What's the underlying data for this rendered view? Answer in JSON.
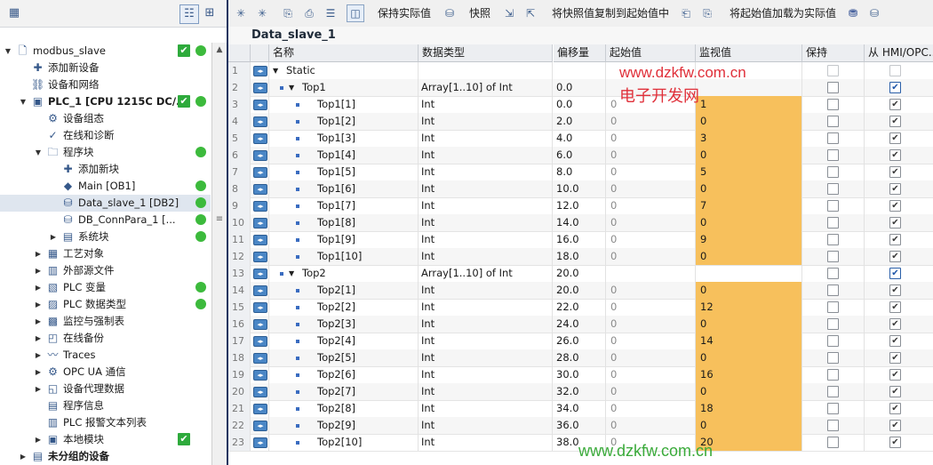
{
  "left_panel": {
    "tree": [
      {
        "label": "modbus_slave",
        "expander": "▼",
        "icon": "document-icon",
        "check": true,
        "dot": true
      },
      {
        "label": "添加新设备",
        "expander": "",
        "icon": "add-device-icon",
        "check": false,
        "dot": false
      },
      {
        "label": "设备和网络",
        "expander": "",
        "icon": "network-icon",
        "check": false,
        "dot": false
      },
      {
        "label": "PLC_1 [CPU 1215C DC/...",
        "expander": "▼",
        "icon": "plc-icon",
        "check": true,
        "dot": true,
        "bold": true
      },
      {
        "label": "设备组态",
        "expander": "",
        "icon": "device-config-icon",
        "check": false,
        "dot": false
      },
      {
        "label": "在线和诊断",
        "expander": "",
        "icon": "diagnostics-icon",
        "check": false,
        "dot": false
      },
      {
        "label": "程序块",
        "expander": "▼",
        "icon": "folder-icon",
        "check": false,
        "dot": true
      },
      {
        "label": "添加新块",
        "expander": "",
        "icon": "add-block-icon",
        "check": false,
        "dot": false
      },
      {
        "label": "Main [OB1]",
        "expander": "",
        "icon": "ob-icon",
        "check": false,
        "dot": true
      },
      {
        "label": "Data_slave_1 [DB2]",
        "expander": "",
        "icon": "db-icon",
        "check": false,
        "dot": true,
        "selected": true
      },
      {
        "label": "DB_ConnPara_1 [...",
        "expander": "",
        "icon": "db-icon",
        "check": false,
        "dot": true
      },
      {
        "label": "系统块",
        "expander": "▶",
        "icon": "system-block-icon",
        "check": false,
        "dot": true
      },
      {
        "label": "工艺对象",
        "expander": "▶",
        "icon": "tech-object-icon",
        "check": false,
        "dot": false
      },
      {
        "label": "外部源文件",
        "expander": "▶",
        "icon": "external-source-icon",
        "check": false,
        "dot": false
      },
      {
        "label": "PLC 变量",
        "expander": "▶",
        "icon": "plc-tags-icon",
        "check": false,
        "dot": true
      },
      {
        "label": "PLC 数据类型",
        "expander": "▶",
        "icon": "plc-datatype-icon",
        "check": false,
        "dot": true
      },
      {
        "label": "监控与强制表",
        "expander": "▶",
        "icon": "watch-table-icon",
        "check": false,
        "dot": false
      },
      {
        "label": "在线备份",
        "expander": "▶",
        "icon": "online-backup-icon",
        "check": false,
        "dot": false
      },
      {
        "label": "Traces",
        "expander": "▶",
        "icon": "traces-icon",
        "check": false,
        "dot": false
      },
      {
        "label": "OPC UA 通信",
        "expander": "▶",
        "icon": "opcua-icon",
        "check": false,
        "dot": false
      },
      {
        "label": "设备代理数据",
        "expander": "▶",
        "icon": "proxy-data-icon",
        "check": false,
        "dot": false
      },
      {
        "label": "程序信息",
        "expander": "",
        "icon": "program-info-icon",
        "check": false,
        "dot": false
      },
      {
        "label": "PLC 报警文本列表",
        "expander": "",
        "icon": "alarm-text-icon",
        "check": false,
        "dot": false
      },
      {
        "label": "本地模块",
        "expander": "▶",
        "icon": "local-modules-icon",
        "check": true,
        "dot": false
      },
      {
        "label": "未分组的设备",
        "expander": "▶",
        "icon": "ungrouped-devices-icon",
        "check": false,
        "dot": false,
        "bold": true
      }
    ]
  },
  "toolbar": {
    "keep_actual_values": "保持实际值",
    "snapshot": "快照",
    "copy_snapshot_to_start": "将快照值复制到起始值中",
    "load_start_as_actual": "将起始值加载为实际值"
  },
  "editor": {
    "title": "Data_slave_1",
    "columns": {
      "name": "名称",
      "datatype": "数据类型",
      "offset": "偏移量",
      "start_value": "起始值",
      "monitor_value": "监视值",
      "retain": "保持",
      "hmi": "从 HMI/OPC..."
    },
    "rows": [
      {
        "n": "1",
        "level": 0,
        "expand": "▼",
        "name": "Static",
        "type": "",
        "offset": "",
        "start": "",
        "monitor": "",
        "retain": false,
        "hmi": false,
        "hmi_dis": true,
        "retain_dis": true
      },
      {
        "n": "2",
        "level": 1,
        "expand": "▼",
        "name": "Top1",
        "type": "Array[1..10] of Int",
        "offset": "0.0",
        "start": "",
        "monitor": "",
        "retain": false,
        "hmi": true,
        "hmi_blue": true
      },
      {
        "n": "3",
        "level": 2,
        "expand": "",
        "name": "Top1[1]",
        "type": "Int",
        "offset": "0.0",
        "start": "0",
        "monitor": "1",
        "retain": false,
        "hmi": true
      },
      {
        "n": "4",
        "level": 2,
        "expand": "",
        "name": "Top1[2]",
        "type": "Int",
        "offset": "2.0",
        "start": "0",
        "monitor": "0",
        "retain": false,
        "hmi": true
      },
      {
        "n": "5",
        "level": 2,
        "expand": "",
        "name": "Top1[3]",
        "type": "Int",
        "offset": "4.0",
        "start": "0",
        "monitor": "3",
        "retain": false,
        "hmi": true
      },
      {
        "n": "6",
        "level": 2,
        "expand": "",
        "name": "Top1[4]",
        "type": "Int",
        "offset": "6.0",
        "start": "0",
        "monitor": "0",
        "retain": false,
        "hmi": true
      },
      {
        "n": "7",
        "level": 2,
        "expand": "",
        "name": "Top1[5]",
        "type": "Int",
        "offset": "8.0",
        "start": "0",
        "monitor": "5",
        "retain": false,
        "hmi": true
      },
      {
        "n": "8",
        "level": 2,
        "expand": "",
        "name": "Top1[6]",
        "type": "Int",
        "offset": "10.0",
        "start": "0",
        "monitor": "0",
        "retain": false,
        "hmi": true
      },
      {
        "n": "9",
        "level": 2,
        "expand": "",
        "name": "Top1[7]",
        "type": "Int",
        "offset": "12.0",
        "start": "0",
        "monitor": "7",
        "retain": false,
        "hmi": true
      },
      {
        "n": "10",
        "level": 2,
        "expand": "",
        "name": "Top1[8]",
        "type": "Int",
        "offset": "14.0",
        "start": "0",
        "monitor": "0",
        "retain": false,
        "hmi": true
      },
      {
        "n": "11",
        "level": 2,
        "expand": "",
        "name": "Top1[9]",
        "type": "Int",
        "offset": "16.0",
        "start": "0",
        "monitor": "9",
        "retain": false,
        "hmi": true
      },
      {
        "n": "12",
        "level": 2,
        "expand": "",
        "name": "Top1[10]",
        "type": "Int",
        "offset": "18.0",
        "start": "0",
        "monitor": "0",
        "retain": false,
        "hmi": true
      },
      {
        "n": "13",
        "level": 1,
        "expand": "▼",
        "name": "Top2",
        "type": "Array[1..10] of Int",
        "offset": "20.0",
        "start": "",
        "monitor": "",
        "retain": false,
        "hmi": true,
        "hmi_blue": true,
        "dropdown": true
      },
      {
        "n": "14",
        "level": 2,
        "expand": "",
        "name": "Top2[1]",
        "type": "Int",
        "offset": "20.0",
        "start": "0",
        "monitor": "0",
        "retain": false,
        "hmi": true
      },
      {
        "n": "15",
        "level": 2,
        "expand": "",
        "name": "Top2[2]",
        "type": "Int",
        "offset": "22.0",
        "start": "0",
        "monitor": "12",
        "retain": false,
        "hmi": true
      },
      {
        "n": "16",
        "level": 2,
        "expand": "",
        "name": "Top2[3]",
        "type": "Int",
        "offset": "24.0",
        "start": "0",
        "monitor": "0",
        "retain": false,
        "hmi": true
      },
      {
        "n": "17",
        "level": 2,
        "expand": "",
        "name": "Top2[4]",
        "type": "Int",
        "offset": "26.0",
        "start": "0",
        "monitor": "14",
        "retain": false,
        "hmi": true
      },
      {
        "n": "18",
        "level": 2,
        "expand": "",
        "name": "Top2[5]",
        "type": "Int",
        "offset": "28.0",
        "start": "0",
        "monitor": "0",
        "retain": false,
        "hmi": true
      },
      {
        "n": "19",
        "level": 2,
        "expand": "",
        "name": "Top2[6]",
        "type": "Int",
        "offset": "30.0",
        "start": "0",
        "monitor": "16",
        "retain": false,
        "hmi": true
      },
      {
        "n": "20",
        "level": 2,
        "expand": "",
        "name": "Top2[7]",
        "type": "Int",
        "offset": "32.0",
        "start": "0",
        "monitor": "0",
        "retain": false,
        "hmi": true
      },
      {
        "n": "21",
        "level": 2,
        "expand": "",
        "name": "Top2[8]",
        "type": "Int",
        "offset": "34.0",
        "start": "0",
        "monitor": "18",
        "retain": false,
        "hmi": true
      },
      {
        "n": "22",
        "level": 2,
        "expand": "",
        "name": "Top2[9]",
        "type": "Int",
        "offset": "36.0",
        "start": "0",
        "monitor": "0",
        "retain": false,
        "hmi": true
      },
      {
        "n": "23",
        "level": 2,
        "expand": "",
        "name": "Top2[10]",
        "type": "Int",
        "offset": "38.0",
        "start": "0",
        "monitor": "20",
        "retain": false,
        "hmi": true
      }
    ]
  },
  "watermark": {
    "url_top": "www.dzkfw.com.cn",
    "site_name": "电子开发网",
    "url_bottom": "www.dzkfw.com.cn"
  },
  "colors": {
    "monitor_highlight": "#f7c05c",
    "status_green": "#3cba3c",
    "splitter": "#1e3560",
    "watermark_red": "#e0303a"
  }
}
